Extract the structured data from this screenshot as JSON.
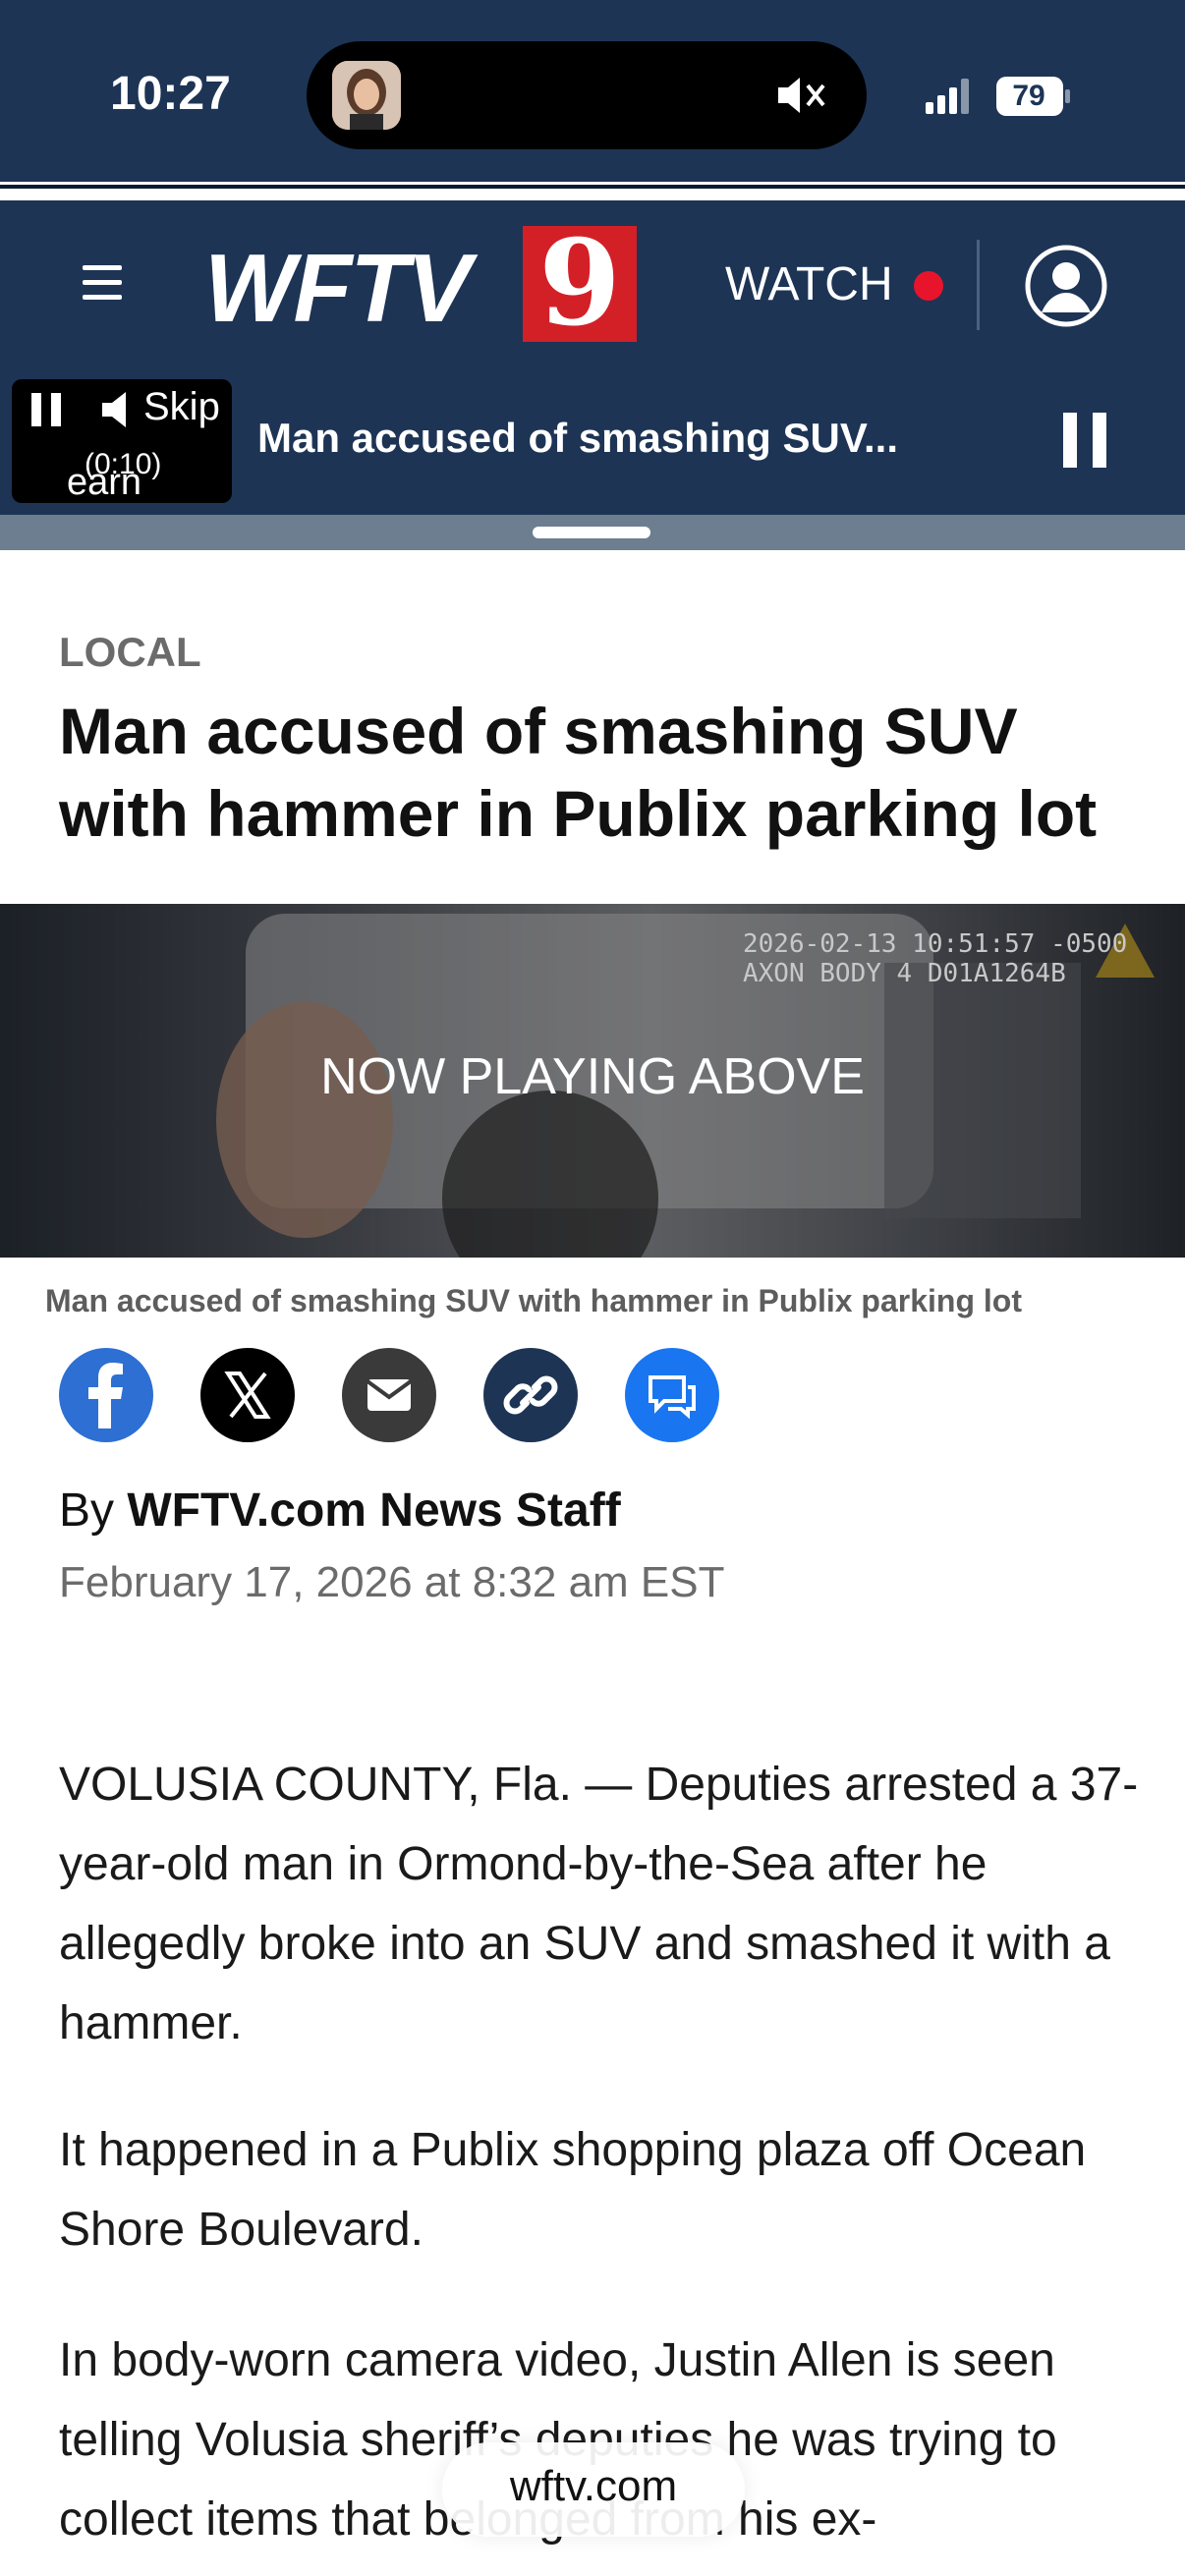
{
  "status_bar": {
    "time": "10:27",
    "battery": "79"
  },
  "header": {
    "logo_text": "WFTV",
    "logo_number": "9",
    "watch_label": "WATCH",
    "accent_red": "#e8142b",
    "brand_navy": "#1d3455"
  },
  "mini_player": {
    "skip_label": "Skip",
    "countdown": "(0:10)",
    "earn_label": "earn",
    "title": "Man accused of smashing SUV..."
  },
  "article": {
    "category": "LOCAL",
    "headline": "Man accused of smashing SUV with hammer in Publix parking lot",
    "video": {
      "timestamp": "2026-02-13 10:51:57 -0500",
      "device": "AXON BODY 4 D01A1264B",
      "overlay_label": "NOW PLAYING ABOVE"
    },
    "caption": "Man accused of smashing SUV with hammer in Publix parking lot",
    "share_icons": [
      "facebook-icon",
      "x-icon",
      "email-icon",
      "link-icon",
      "comments-icon"
    ],
    "byline_prefix": "By",
    "author": "WFTV.com News Staff",
    "date": "February 17, 2026 at 8:32 am EST",
    "paragraphs": [
      "VOLUSIA COUNTY, Fla. — Deputies arrested a 37-year-old man in Ormond-by-the-Sea after he allegedly broke into an SUV and smashed it with a hammer.",
      "It happened in a Publix shopping plaza off Ocean Shore Boulevard.",
      "In body-worn camera video, Justin Allen is seen telling Volusia sheriff’s deputies he was trying to collect items that belonged from his ex-"
    ]
  },
  "browser": {
    "url": "wftv.com"
  }
}
